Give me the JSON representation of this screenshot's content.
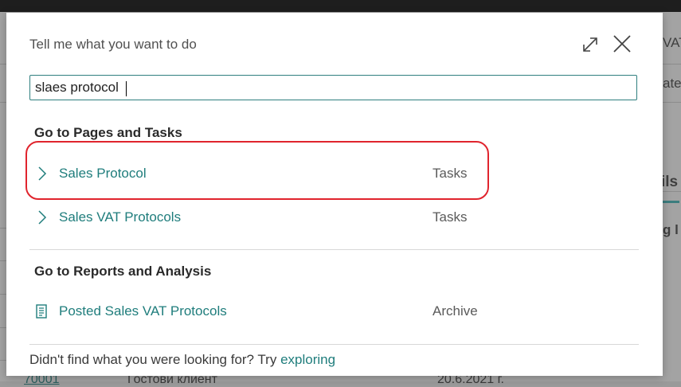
{
  "background": {
    "right_top_text": "VAT",
    "right_sub_text": "ate",
    "right_tab_text": "ils",
    "right_row_text": "g l",
    "bottom_row": {
      "code": "70001",
      "name": "Гостови клиент",
      "date": "20.6.2021 г."
    }
  },
  "dialog": {
    "title": "Tell me what you want to do",
    "expand_icon": "expand-diagonal-icon",
    "close_icon": "close-icon"
  },
  "search": {
    "value": "slaes protocol",
    "placeholder": ""
  },
  "sections": [
    {
      "heading": "Go to Pages and Tasks",
      "results": [
        {
          "label": "Sales Protocol",
          "category": "Tasks",
          "icon": "chevron-right-icon",
          "highlighted": true
        },
        {
          "label": "Sales VAT Protocols",
          "category": "Tasks",
          "icon": "chevron-right-icon"
        }
      ]
    },
    {
      "heading": "Go to Reports and Analysis",
      "results": [
        {
          "label": "Posted Sales VAT Protocols",
          "category": "Archive",
          "icon": "report-document-icon"
        }
      ]
    }
  ],
  "footer": {
    "text": "Didn't find what you were looking for? Try ",
    "link": "exploring"
  },
  "colors": {
    "accent": "#1f7d7c",
    "highlight": "#e0242d"
  }
}
